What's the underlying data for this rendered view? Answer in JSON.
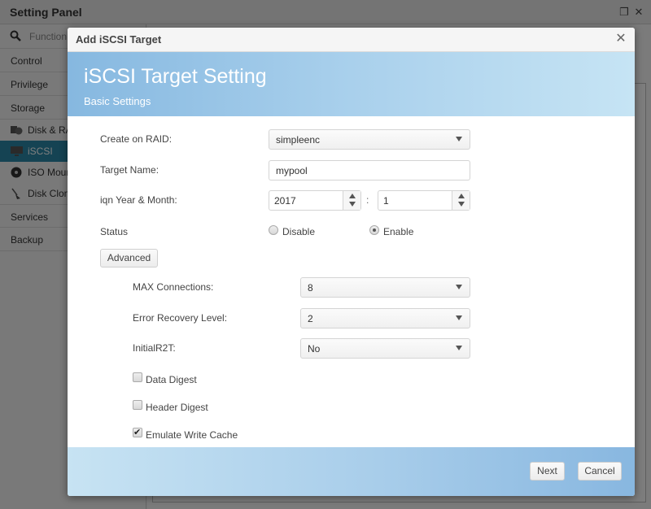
{
  "app": {
    "title": "Setting Panel",
    "search_placeholder": "Function",
    "nav": [
      {
        "label": "Control"
      },
      {
        "label": "Privilege"
      },
      {
        "label": "Storage"
      }
    ],
    "storage_subitems": [
      {
        "label": "Disk & RAID",
        "icon": "disk-raid-icon"
      },
      {
        "label": "iSCSI",
        "icon": "iscsi-icon",
        "active": true
      },
      {
        "label": "ISO Mount",
        "icon": "iso-mount-icon"
      },
      {
        "label": "Disk Clone",
        "icon": "disk-clone-icon"
      }
    ],
    "nav_after": [
      {
        "label": "Services"
      },
      {
        "label": "Backup"
      }
    ],
    "accent_color": "#2a86a6"
  },
  "dialog": {
    "title": "Add iSCSI Target",
    "banner_title": "iSCSI Target Setting",
    "banner_subtitle": "Basic Settings",
    "fields": {
      "raid_label": "Create on RAID:",
      "raid_value": "simpleenc",
      "target_name_label": "Target Name:",
      "target_name_value": "mypool",
      "iqn_label": "iqn Year & Month:",
      "iqn_year": "2017",
      "iqn_separator": ":",
      "iqn_month": "1",
      "status_label": "Status",
      "status_disable": "Disable",
      "status_enable": "Enable",
      "status_selected": "Enable"
    },
    "advanced_button": "Advanced",
    "advanced": {
      "max_conn_label": "MAX Connections:",
      "max_conn_value": "8",
      "error_recovery_label": "Error Recovery Level:",
      "error_recovery_value": "2",
      "initial_r2t_label": "InitialR2T:",
      "initial_r2t_value": "No",
      "data_digest_label": "Data Digest",
      "data_digest_checked": false,
      "header_digest_label": "Header Digest",
      "header_digest_checked": false,
      "emulate_write_cache_label": "Emulate Write Cache",
      "emulate_write_cache_checked": true
    },
    "footer": {
      "next_label": "Next",
      "cancel_label": "Cancel"
    }
  }
}
